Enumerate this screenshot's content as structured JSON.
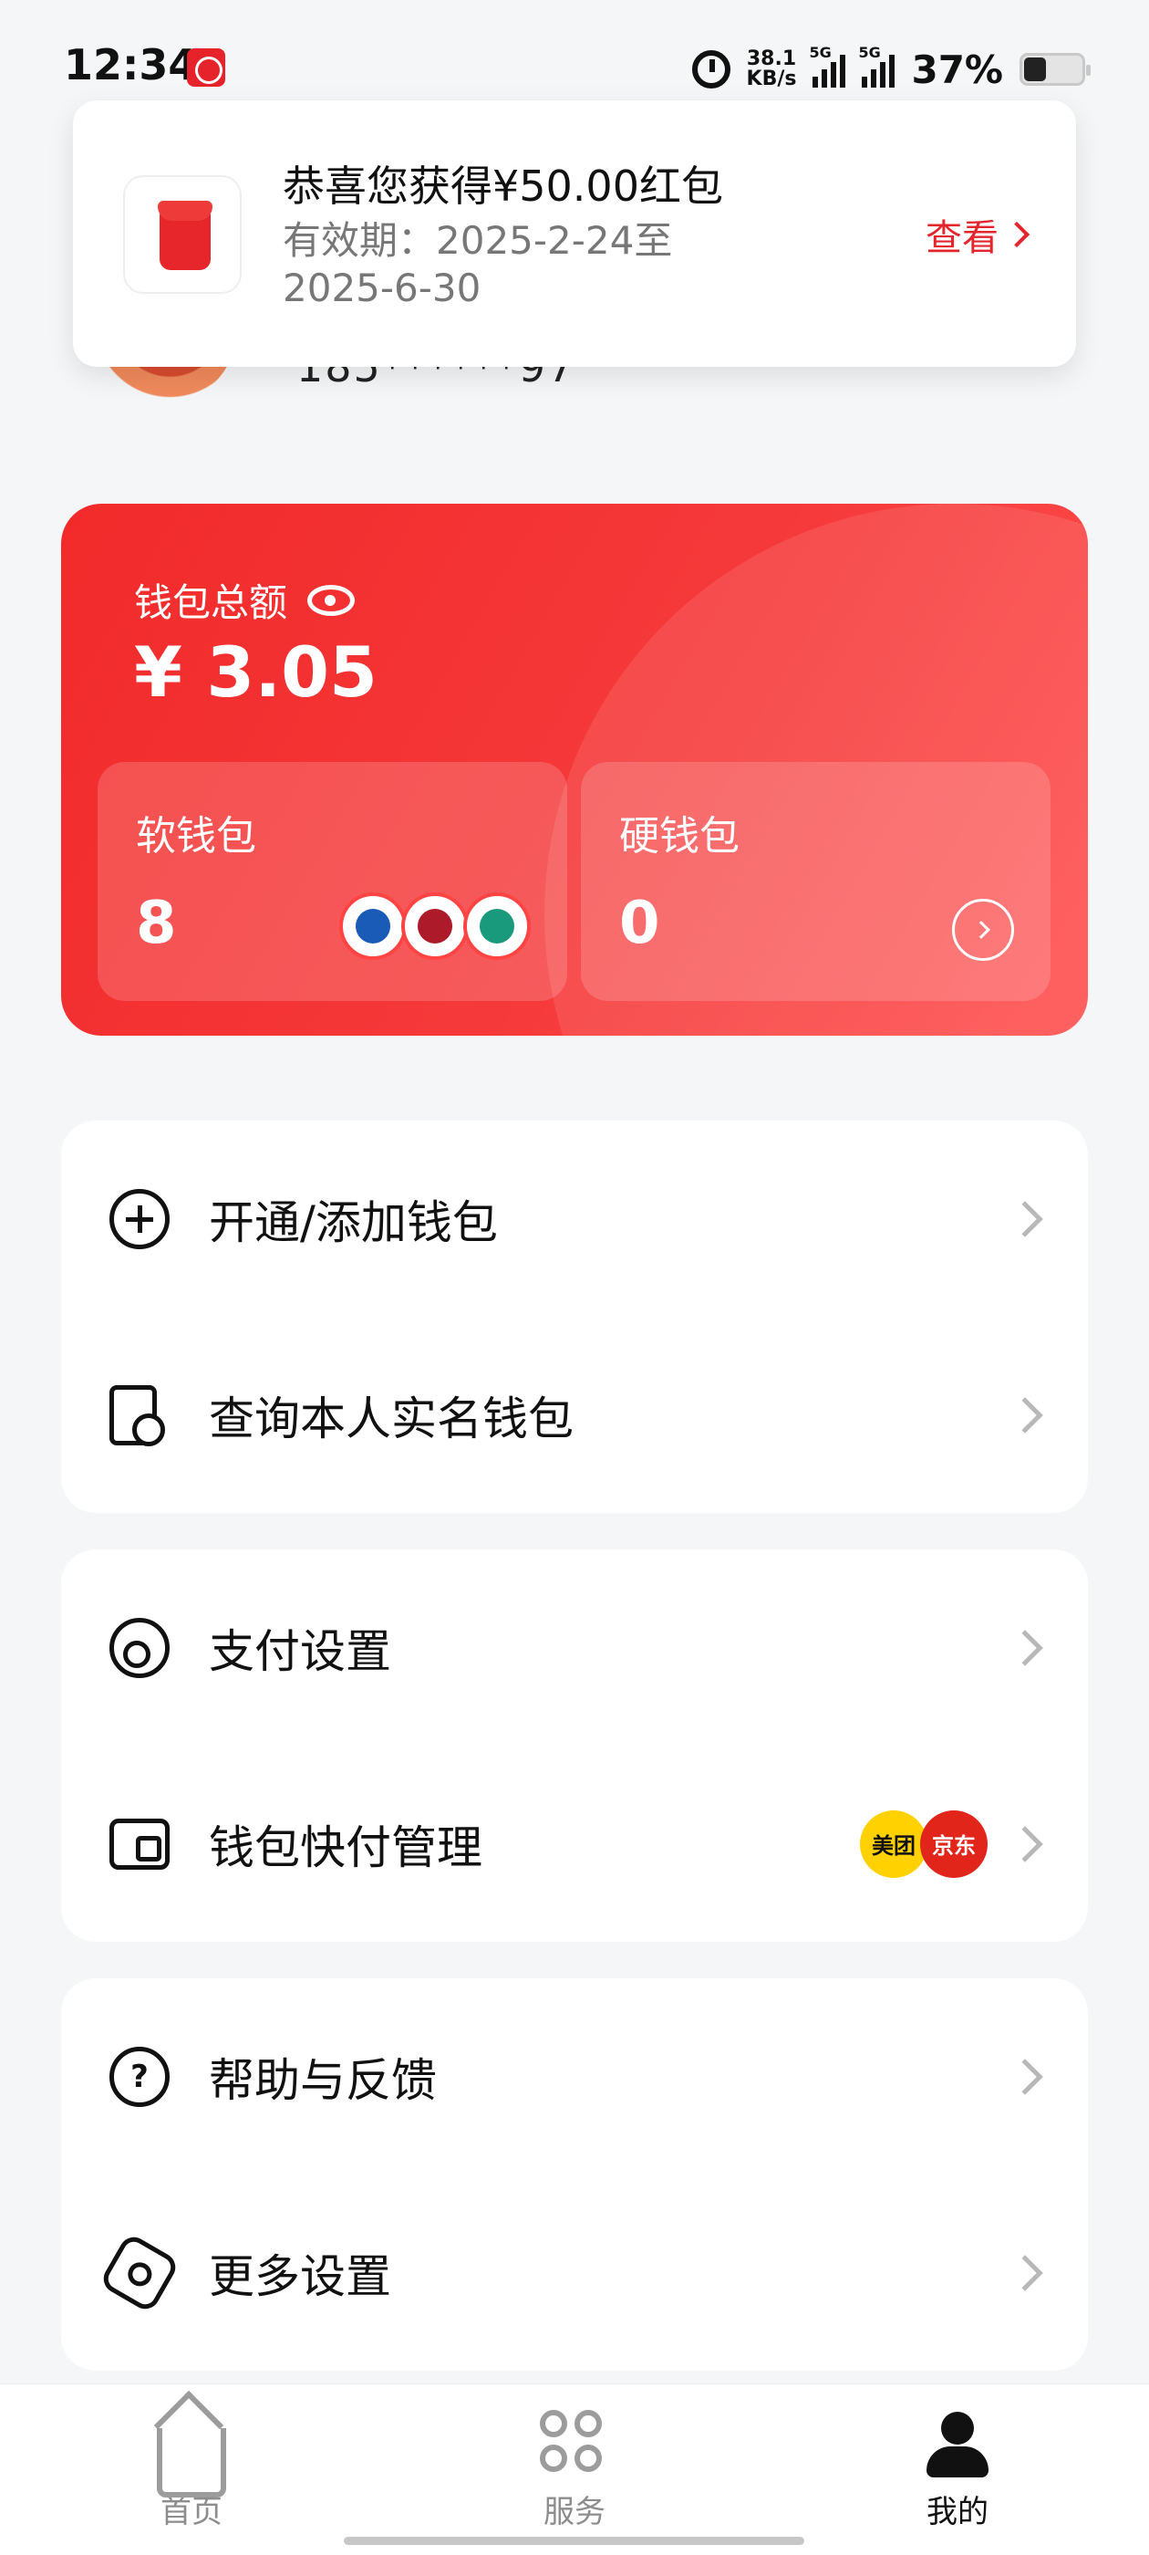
{
  "status_bar": {
    "time": "12:34",
    "net_speed_value": "38.1",
    "net_speed_unit": "KB/s",
    "signal_label_1": "5G",
    "signal_label_2": "5G",
    "battery": "37%"
  },
  "profile": {
    "phone": "185******97"
  },
  "notification": {
    "title": "恭喜您获得¥50.00红包",
    "validity": "有效期：2025-2-24至2025-6-30",
    "action": "查看"
  },
  "wallet": {
    "total_label": "钱包总额",
    "total_value": "¥ 3.05",
    "soft_label": "软钱包",
    "soft_value": "8",
    "hard_label": "硬钱包",
    "hard_value": "0",
    "bank_icons": [
      "ccb-icon",
      "boc-icon",
      "abc-icon"
    ]
  },
  "menu": {
    "open_add_wallet": "开通/添加钱包",
    "query_realname_wallet": "查询本人实名钱包",
    "payment_settings": "支付设置",
    "wallet_quickpay": "钱包快付管理",
    "partner_meituan": "美团",
    "partner_jd": "京东",
    "help_feedback": "帮助与反馈",
    "more_settings": "更多设置"
  },
  "bottom_nav": {
    "home": "首页",
    "services": "服务",
    "mine": "我的",
    "active": "mine"
  },
  "colors": {
    "brand_red": "#f22a2a",
    "accent_red_text": "#e3262c",
    "background": "#f5f6f8"
  }
}
